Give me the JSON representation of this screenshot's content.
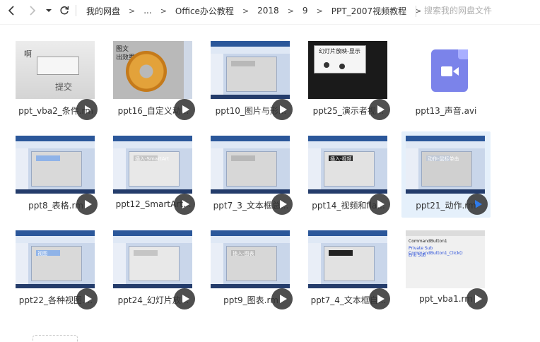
{
  "navigation": {
    "breadcrumbs": [
      "我的网盘",
      "...",
      "Office办公教程",
      "2018",
      "9",
      "PPT_2007视频教程"
    ],
    "separator": ">",
    "search_placeholder": "搜索我的网盘文件"
  },
  "colors": {
    "selected_tile": "#e5f0fb",
    "video_icon": "#7b83ea",
    "play_button": "#282828",
    "play_button_selected": "#2f7bea"
  },
  "files": [
    {
      "name": "ppt_vba2_条件.rm",
      "thumb": "vba2",
      "thumb_text": [
        "啊",
        "提交"
      ],
      "type": "video"
    },
    {
      "name": "ppt16_自定义动...",
      "thumb": "p16",
      "thumb_text": [
        "图文",
        "出效果"
      ],
      "type": "video"
    },
    {
      "name": "ppt10_图片与形...",
      "thumb": "win",
      "type": "video"
    },
    {
      "name": "ppt25_演示者视...",
      "thumb": "p25",
      "thumb_text": [
        "幻灯片放映-显示"
      ],
      "type": "video"
    },
    {
      "name": "ppt13_声音.avi",
      "thumb": "avi",
      "type": "video-file-icon"
    },
    {
      "name": "ppt8_表格.rm",
      "thumb": "win",
      "type": "video"
    },
    {
      "name": "ppt12_SmartArt...",
      "thumb": "win",
      "thumb_text": [
        "插入-SmartArt"
      ],
      "type": "video"
    },
    {
      "name": "ppt7_3_文本框总...",
      "thumb": "win",
      "type": "video"
    },
    {
      "name": "ppt14_视频和fla...",
      "thumb": "win",
      "thumb_text": [
        "插入-视频"
      ],
      "type": "video"
    },
    {
      "name": "ppt21_动作.rm",
      "thumb": "win",
      "thumb_text": [
        "动作-鼠标单击"
      ],
      "type": "video",
      "selected": true
    },
    {
      "name": "ppt22_各种视图....",
      "thumb": "win",
      "thumb_text": [
        "视图"
      ],
      "type": "video"
    },
    {
      "name": "ppt24_幻灯片放...",
      "thumb": "win",
      "type": "video"
    },
    {
      "name": "ppt9_图表.rm",
      "thumb": "win",
      "thumb_text": [
        "插入-图表"
      ],
      "type": "video"
    },
    {
      "name": "ppt7_4_文本框自...",
      "thumb": "win",
      "type": "video"
    },
    {
      "name": "ppt_vba1.rm",
      "thumb": "code",
      "thumb_text": [
        "CommandButton1",
        "Private Sub CommandButton1_Click()",
        "End Sub"
      ],
      "type": "video"
    }
  ]
}
